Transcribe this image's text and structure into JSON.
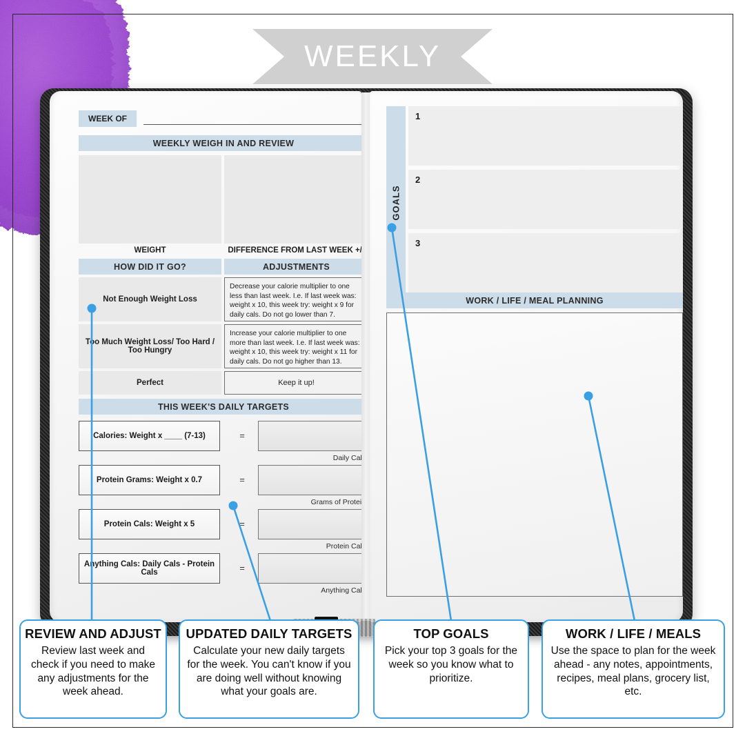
{
  "banner": {
    "title": "WEEKLY"
  },
  "left_page": {
    "week_of_label": "WEEK OF",
    "weigh_header": "WEEKLY WEIGH IN AND REVIEW",
    "weight_caption": "WEIGHT",
    "difference_caption": "DIFFERENCE FROM LAST WEEK +/-",
    "how_header": "HOW DID IT GO?",
    "adjustments_header": "ADJUSTMENTS",
    "review_rows": [
      {
        "condition": "Not Enough Weight Loss",
        "adjustment": "Decrease your calorie multiplier to one less than last week. I.e. If last week was: weight x 10, this week try: weight x 9 for daily cals. Do not go lower than 7."
      },
      {
        "condition": "Too Much Weight Loss/ Too Hard / Too Hungry",
        "adjustment": "Increase your calorie multiplier to one more than last week. I.e. If last week was: weight x 10, this week try: weight x 11 for daily cals. Do not go higher than 13."
      },
      {
        "condition": "Perfect",
        "adjustment": "Keep it up!"
      }
    ],
    "targets_header": "THIS WEEK'S DAILY TARGETS",
    "targets": [
      {
        "formula": "Calories: Weight x ____ (7-13)",
        "equals": "=",
        "result_caption": "Daily Cals"
      },
      {
        "formula": "Protein Grams: Weight x 0.7",
        "equals": "=",
        "result_caption": "Grams of Protein"
      },
      {
        "formula": "Protein Cals: Weight x 5",
        "equals": "=",
        "result_caption": "Protein Cals"
      },
      {
        "formula": "Anything Cals: Daily Cals - Protein Cals",
        "equals": "=",
        "result_caption": "Anything Cals"
      }
    ]
  },
  "right_page": {
    "goals_tab_label": "GOALS",
    "goals": [
      "1",
      "2",
      "3"
    ],
    "work_header": "WORK / LIFE / MEAL PLANNING"
  },
  "callouts": [
    {
      "title": "REVIEW AND ADJUST",
      "body": "Review last week and check if you need to make any adjustments for the week ahead."
    },
    {
      "title": "UPDATED DAILY TARGETS",
      "body": "Calculate your new daily targets for the week. You can't know if you are doing well without knowing what your goals are."
    },
    {
      "title": "TOP GOALS",
      "body": "Pick your top 3 goals for the week so you know what to prioritize."
    },
    {
      "title": "WORK / LIFE / MEALS",
      "body": "Use the space to plan for the week ahead - any notes, appointments, recipes, meal plans, grocery list, etc."
    }
  ],
  "colors": {
    "accent_blue": "#3a9fe3",
    "header_blue": "#cddce9",
    "ribbon_gray": "#cfcfcf",
    "watercolor_purple": "#9b3fd4",
    "cover_dark": "#2b2b2b"
  }
}
